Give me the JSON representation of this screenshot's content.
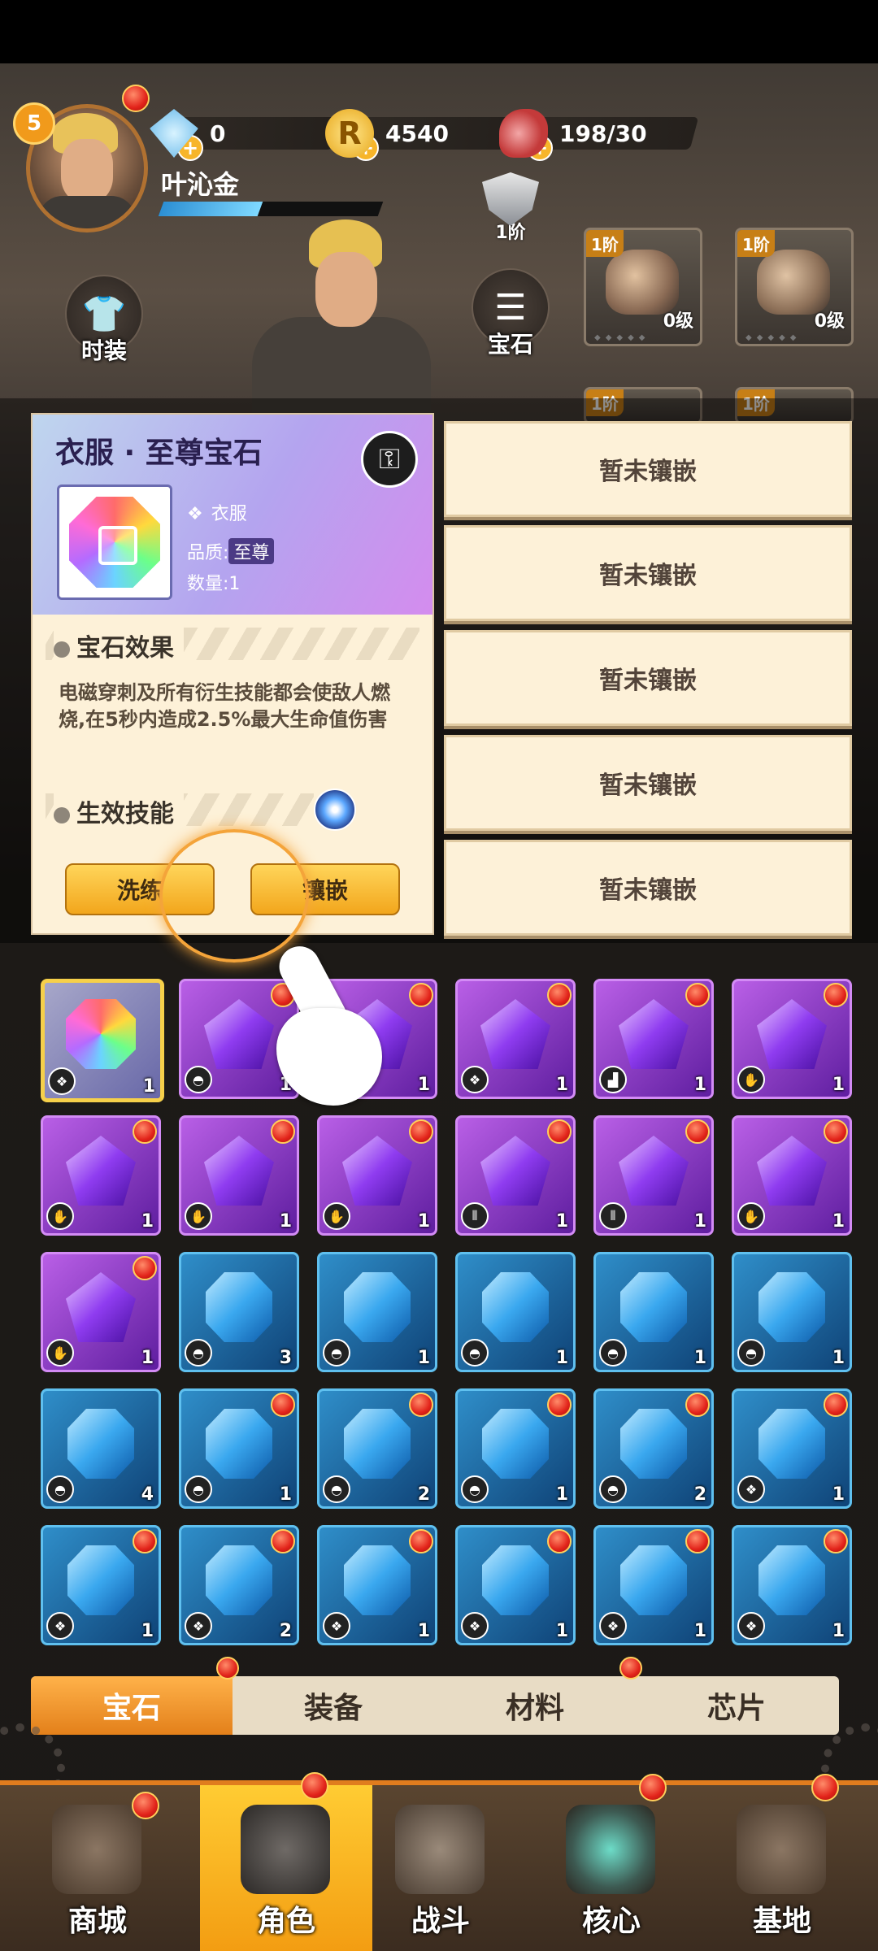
{
  "header": {
    "player_level": "5",
    "player_name": "叶沁金",
    "xp_fraction": 0.45,
    "resources": [
      {
        "icon": "diamond-icon",
        "value": "0"
      },
      {
        "icon": "coin-icon",
        "value": "4540"
      },
      {
        "icon": "meat-stamina-icon",
        "value": "198/30"
      }
    ]
  },
  "side": {
    "fashion_label": "时装",
    "gem_label": "宝石"
  },
  "shield_tier": "1阶",
  "equipment": [
    {
      "tier": "1阶",
      "level": "0级",
      "icon": "helmet-icon"
    },
    {
      "tier": "1阶",
      "level": "0级",
      "icon": "gauntlet-icon"
    },
    {
      "tier": "1阶",
      "icon": "armor-icon"
    },
    {
      "tier": "1阶",
      "icon": "armor-icon"
    }
  ],
  "tooltip": {
    "title": "衣服 · 至尊宝石",
    "slot_name": "衣服",
    "quality_label": "品质:",
    "quality_value": "至尊",
    "count_label": "数量:",
    "count_value": "1",
    "effect_header": "宝石效果",
    "effect_text": "电磁穿刺及所有衍生技能都会使敌人燃烧,在5秒内造成2.5%最大生命值伤害",
    "skill_header": "生效技能",
    "wash_button": "洗练",
    "embed_button": "镶嵌"
  },
  "socket_slots": [
    "暂未镶嵌",
    "暂未镶嵌",
    "暂未镶嵌",
    "暂未镶嵌",
    "暂未镶嵌"
  ],
  "gems": [
    {
      "type": "rainbow",
      "slot": "clothes",
      "count": "1",
      "dot": false,
      "selected": true
    },
    {
      "type": "purple",
      "slot": "helmet",
      "count": "1",
      "dot": true
    },
    {
      "type": "purple",
      "slot": "helmet",
      "count": "1",
      "dot": true
    },
    {
      "type": "purple",
      "slot": "clothes",
      "count": "1",
      "dot": true
    },
    {
      "type": "purple",
      "slot": "boots",
      "count": "1",
      "dot": true
    },
    {
      "type": "purple",
      "slot": "gauntlet",
      "count": "1",
      "dot": true
    },
    {
      "type": "purple",
      "slot": "gauntlet",
      "count": "1",
      "dot": true
    },
    {
      "type": "purple",
      "slot": "gauntlet",
      "count": "1",
      "dot": true
    },
    {
      "type": "purple",
      "slot": "gauntlet",
      "count": "1",
      "dot": true
    },
    {
      "type": "purple",
      "slot": "pants",
      "count": "1",
      "dot": true
    },
    {
      "type": "purple",
      "slot": "pants",
      "count": "1",
      "dot": true
    },
    {
      "type": "purple",
      "slot": "glove",
      "count": "1",
      "dot": true
    },
    {
      "type": "purple",
      "slot": "glove",
      "count": "1",
      "dot": true
    },
    {
      "type": "blue",
      "slot": "helmet",
      "count": "3",
      "dot": false
    },
    {
      "type": "blue",
      "slot": "helmet",
      "count": "1",
      "dot": false
    },
    {
      "type": "blue",
      "slot": "helmet",
      "count": "1",
      "dot": false
    },
    {
      "type": "blue",
      "slot": "helmet",
      "count": "1",
      "dot": false
    },
    {
      "type": "blue",
      "slot": "helmet",
      "count": "1",
      "dot": false
    },
    {
      "type": "blue",
      "slot": "helmet",
      "count": "4",
      "dot": false
    },
    {
      "type": "blue",
      "slot": "helmet",
      "count": "1",
      "dot": true
    },
    {
      "type": "blue",
      "slot": "helmet",
      "count": "2",
      "dot": true
    },
    {
      "type": "blue",
      "slot": "helmet",
      "count": "1",
      "dot": true
    },
    {
      "type": "blue",
      "slot": "helmet",
      "count": "2",
      "dot": true
    },
    {
      "type": "blue",
      "slot": "clothes",
      "count": "1",
      "dot": true
    },
    {
      "type": "blue",
      "slot": "clothes",
      "count": "1",
      "dot": true
    },
    {
      "type": "blue",
      "slot": "clothes",
      "count": "2",
      "dot": true
    },
    {
      "type": "blue",
      "slot": "clothes",
      "count": "1",
      "dot": true
    },
    {
      "type": "blue",
      "slot": "clothes",
      "count": "1",
      "dot": true
    },
    {
      "type": "blue",
      "slot": "clothes",
      "count": "1",
      "dot": true
    },
    {
      "type": "blue",
      "slot": "clothes",
      "count": "1",
      "dot": true
    }
  ],
  "tabs": [
    {
      "label": "宝石",
      "active": true
    },
    {
      "label": "装备",
      "active": false
    },
    {
      "label": "材料",
      "active": false
    },
    {
      "label": "芯片",
      "active": false
    }
  ],
  "nav": [
    {
      "label": "商城",
      "icon": "shop-building-icon",
      "active": false
    },
    {
      "label": "角色",
      "icon": "character-soldier-icon",
      "active": true
    },
    {
      "label": "战斗",
      "icon": "crossed-guns-icon",
      "active": false
    },
    {
      "label": "核心",
      "icon": "core-crystal-icon",
      "active": false
    },
    {
      "label": "基地",
      "icon": "base-tower-icon",
      "active": false
    }
  ],
  "colors": {
    "accent": "#f39d12",
    "purple_gem": "#8f3cf0",
    "blue_gem": "#3aa8ef",
    "red_dot": "#e2231a"
  }
}
